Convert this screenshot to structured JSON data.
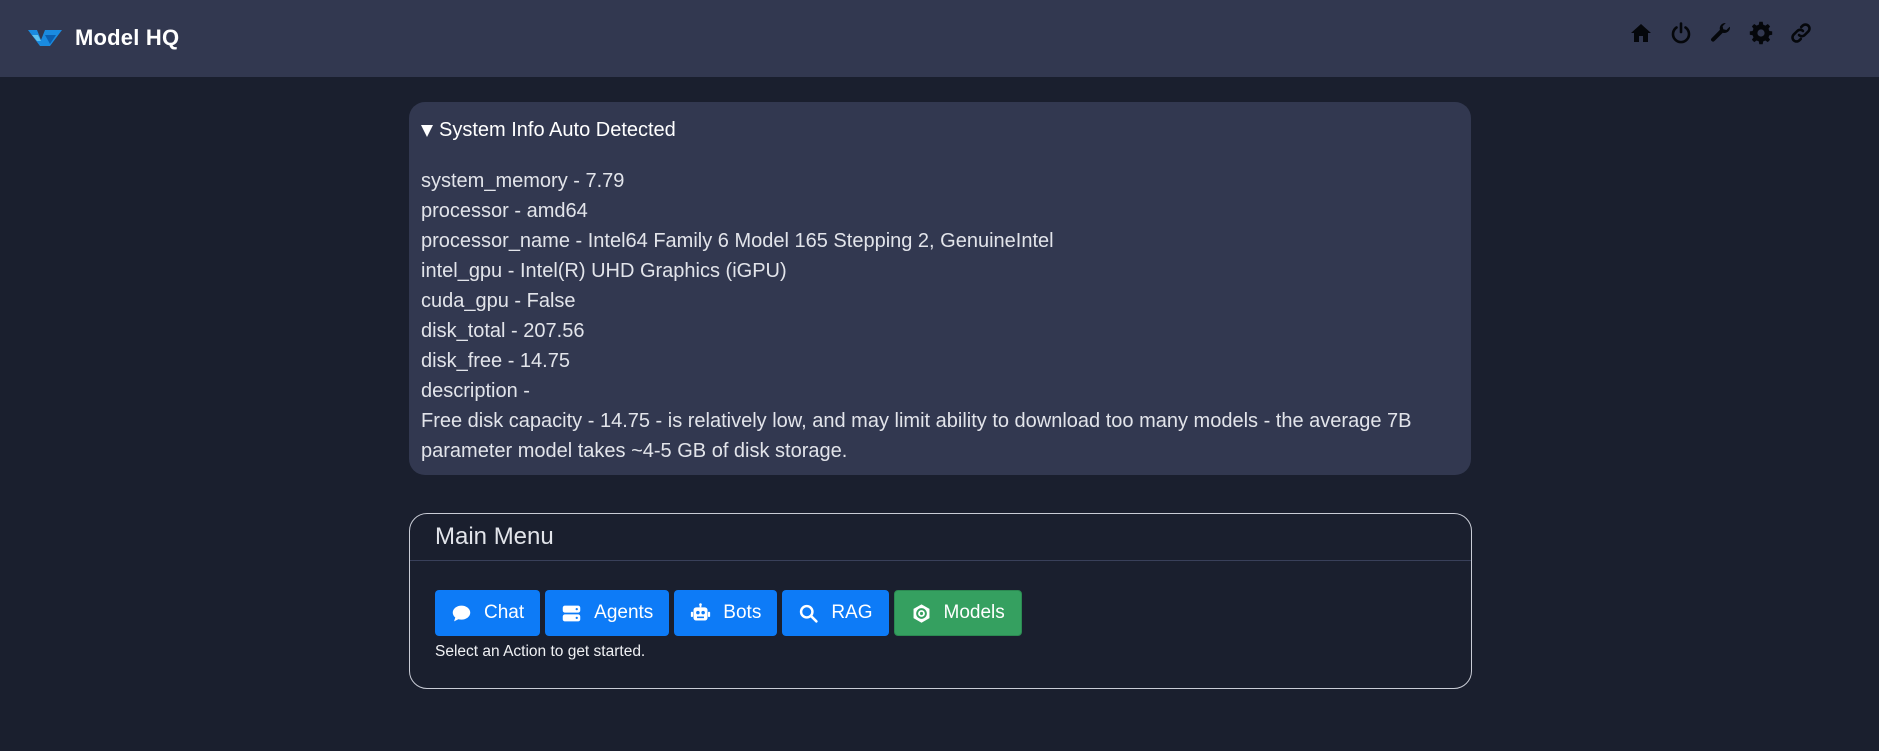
{
  "app": {
    "title": "Model HQ"
  },
  "nav_icons": [
    "home-icon",
    "power-icon",
    "wrench-icon",
    "gear-icon",
    "link-icon"
  ],
  "colors": {
    "background": "#1a1f2e",
    "panel": "#323850",
    "primary_button": "#0d7bf7",
    "success_button": "#35a060"
  },
  "system_info": {
    "summary": "System Info Auto Detected",
    "lines": [
      "system_memory - 7.79",
      "processor - amd64",
      "processor_name - Intel64 Family 6 Model 165 Stepping 2, GenuineIntel",
      "intel_gpu - Intel(R) UHD Graphics (iGPU)",
      "cuda_gpu - False",
      "disk_total - 207.56",
      "disk_free - 14.75",
      "description -"
    ],
    "note": "Free disk capacity - 14.75 - is relatively low, and may limit ability to download too many models - the average 7B parameter model takes ~4-5 GB of disk storage."
  },
  "main_menu": {
    "title": "Main Menu",
    "buttons": [
      {
        "label": "Chat",
        "icon": "chat-bubble-icon"
      },
      {
        "label": "Agents",
        "icon": "server-icon"
      },
      {
        "label": "Bots",
        "icon": "robot-icon"
      },
      {
        "label": "RAG",
        "icon": "search-icon"
      },
      {
        "label": "Models",
        "icon": "gear-icon"
      }
    ],
    "hint": "Select an Action to get started."
  }
}
